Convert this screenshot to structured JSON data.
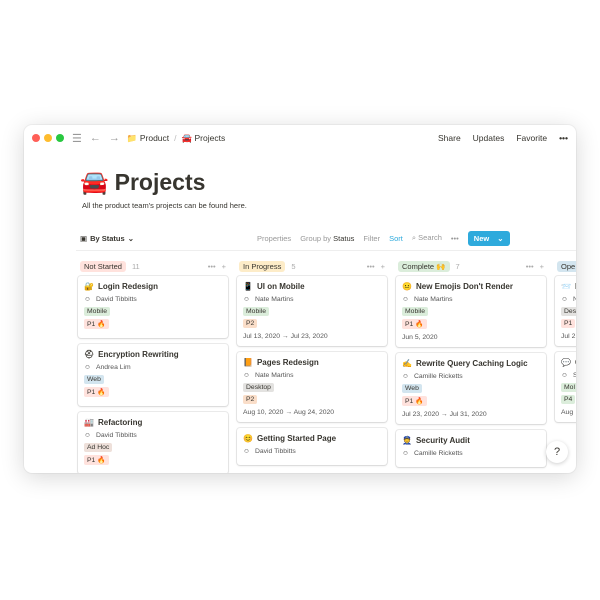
{
  "titlebar": {
    "breadcrumb": [
      {
        "icon": "📁",
        "label": "Product"
      },
      {
        "icon": "🚘",
        "label": "Projects"
      }
    ],
    "share": "Share",
    "updates": "Updates",
    "favorite": "Favorite",
    "more": "•••"
  },
  "page": {
    "icon": "🚘",
    "title": "Projects",
    "description": "All the product team's projects can be found here."
  },
  "toolbar": {
    "view": "By Status",
    "properties": "Properties",
    "group_by": "Group by",
    "group_value": "Status",
    "filter": "Filter",
    "sort": "Sort",
    "search": "Search",
    "more": "•••",
    "new": "New",
    "accent": "#2eaadc"
  },
  "tag_colors": {
    "Mobile": "#dbeddb",
    "Web": "#d3e5ef",
    "Desktop": "#e3e2e0",
    "Ad Hoc": "#eee0da",
    "P1 🔥": "#ffe2dd",
    "P2": "#fadec9",
    "P4": "#dbeddb",
    "Des": "#e3e2e0",
    "Mol": "#dbeddb",
    "P1": "#ffe2dd"
  },
  "columns": [
    {
      "name": "Not Started",
      "count": "11",
      "color": "#ffe2dd",
      "cards": [
        {
          "icon": "🔐",
          "title": "Login Redesign",
          "person": "David Tibbitts",
          "tags": [
            "Mobile",
            "P1 🔥"
          ]
        },
        {
          "icon": "⛑",
          "title": "Encryption Rewriting",
          "person": "Andrea Lim",
          "tags": [
            "Web",
            "P1 🔥"
          ]
        },
        {
          "icon": "🏭",
          "title": "Refactoring",
          "person": "David Tibbitts",
          "tags": [
            "Ad Hoc",
            "P1 🔥"
          ]
        }
      ]
    },
    {
      "name": "In Progress",
      "count": "5",
      "color": "#fdecc8",
      "cards": [
        {
          "icon": "📱",
          "title": "UI on Mobile",
          "person": "Nate Martins",
          "tags": [
            "Mobile",
            "P2"
          ],
          "date": "Jul 13, 2020 → Jul 23, 2020"
        },
        {
          "icon": "📙",
          "title": "Pages Redesign",
          "person": "Nate Martins",
          "tags": [
            "Desktop",
            "P2"
          ],
          "date": "Aug 10, 2020 → Aug 24, 2020"
        },
        {
          "icon": "😊",
          "title": "Getting Started Page",
          "person": "David Tibbitts",
          "tags": []
        }
      ]
    },
    {
      "name": "Complete 🙌",
      "count": "7",
      "color": "#dbeddb",
      "cards": [
        {
          "icon": "😐",
          "title": "New Emojis Don't Render",
          "person": "Nate Martins",
          "tags": [
            "Mobile",
            "P1 🔥"
          ],
          "date": "Jun 5, 2020"
        },
        {
          "icon": "✍️",
          "title": "Rewrite Query Caching Logic",
          "person": "Camille Ricketts",
          "tags": [
            "Web",
            "P1 🔥"
          ],
          "date": "Jul 23, 2020 → Jul 31, 2020"
        },
        {
          "icon": "👮",
          "title": "Security Audit",
          "person": "Camille Ricketts",
          "tags": []
        }
      ]
    },
    {
      "name": "Ope",
      "count": "",
      "color": "#d3e5ef",
      "cards": [
        {
          "icon": "📨",
          "title": "F",
          "person": "N",
          "tags": [
            "Des",
            "P1"
          ],
          "date": "Jul 2"
        },
        {
          "icon": "💬",
          "title": "C",
          "person": "S",
          "tags": [
            "Mol",
            "P4"
          ],
          "date": "Aug"
        }
      ]
    }
  ],
  "help": "?"
}
